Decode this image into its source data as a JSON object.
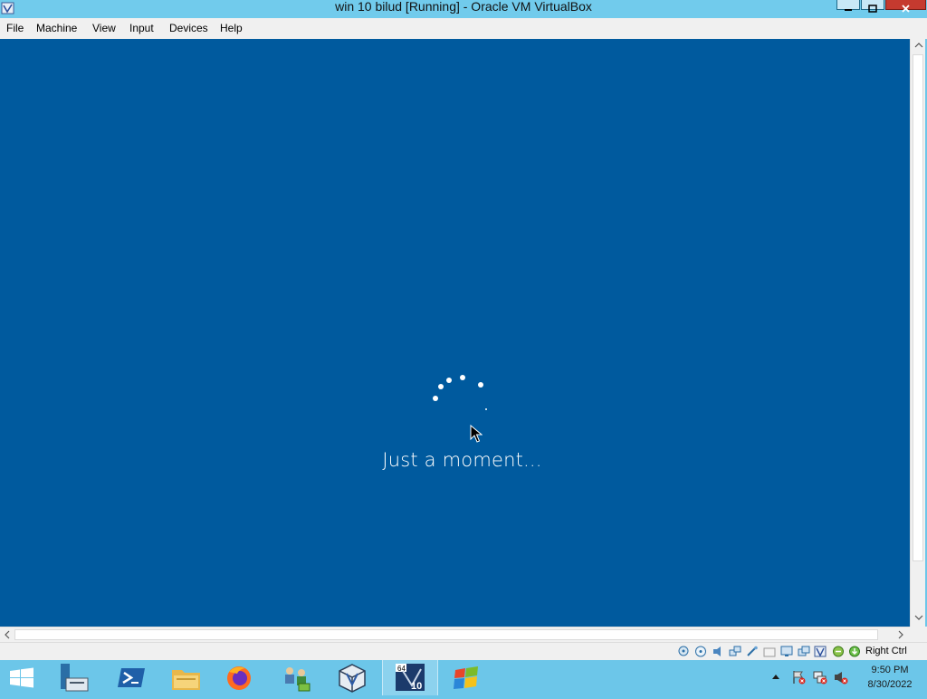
{
  "window": {
    "title": "win 10 bilud [Running] - Oracle VM VirtualBox"
  },
  "menu": {
    "items": [
      "File",
      "Machine",
      "View",
      "Input",
      "Devices",
      "Help"
    ]
  },
  "vm_screen": {
    "background": "#005a9e",
    "loading_text": "Just a moment..."
  },
  "statusbar": {
    "icons": [
      "hard-disk-icon",
      "optical-drive-icon",
      "audio-icon",
      "network-icon",
      "usb-icon",
      "shared-folders-icon",
      "display-icon",
      "video-capture-icon",
      "virtualization-icon",
      "cpu-icon",
      "mouse-integration-icon"
    ],
    "host_key": "Right Ctrl"
  },
  "taskbar": {
    "apps": [
      "start-button",
      "server-manager",
      "powershell",
      "file-explorer",
      "firefox",
      "network-tool",
      "virtualbox",
      "win10-vm",
      "windows-flag-app"
    ],
    "clock": {
      "time": "9:50 PM",
      "date": "8/30/2022"
    }
  }
}
